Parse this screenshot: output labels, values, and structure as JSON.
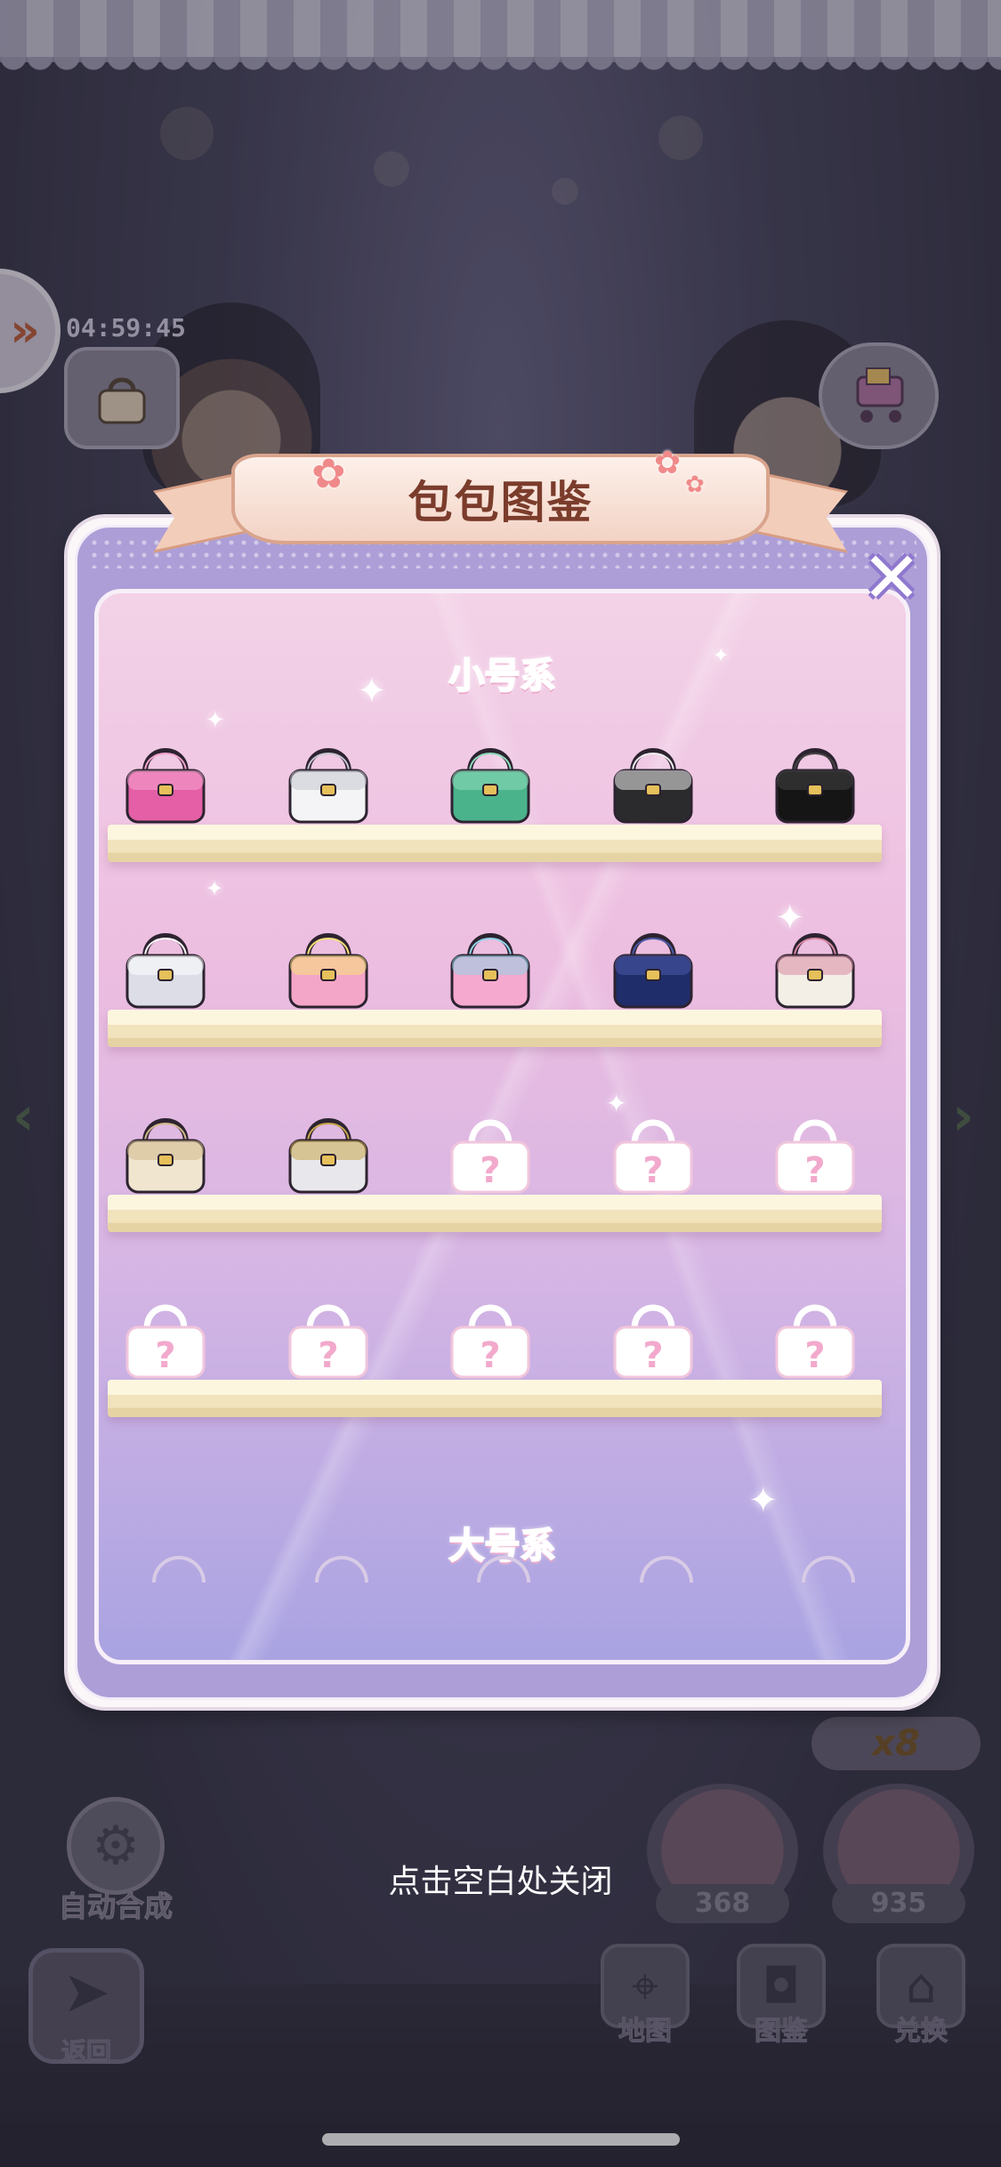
{
  "hud": {
    "timer": "04:59:45",
    "expand_glyph": "»",
    "counter_badge": "x8"
  },
  "icons": {
    "expand": "double-chevron-right-icon",
    "bag_collection": "handbag-icon",
    "shop_cart": "shopping-cart-icon",
    "close": "sparkle-close-icon"
  },
  "modal": {
    "title": "包包图鉴",
    "sections": [
      {
        "name": "小号系"
      },
      {
        "name": "大号系"
      }
    ],
    "small_shelves": [
      [
        {
          "name": "pink-quilted-bag",
          "unlocked": true,
          "body": "#e45fa6",
          "accent": "#f6a6cf"
        },
        {
          "name": "white-flap-bag",
          "unlocked": true,
          "body": "#f4f4f6",
          "accent": "#c7c7d2"
        },
        {
          "name": "green-tote-bag",
          "unlocked": true,
          "body": "#4bb38c",
          "accent": "#8fdcbc"
        },
        {
          "name": "harlequin-bag",
          "unlocked": true,
          "body": "#2b2b2e",
          "accent": "#efefef"
        },
        {
          "name": "black-fur-bag",
          "unlocked": true,
          "body": "#151516",
          "accent": "#444"
        }
      ],
      [
        {
          "name": "silver-pattern-bag",
          "unlocked": true,
          "body": "#dcdde6",
          "accent": "#ffffff"
        },
        {
          "name": "heart-bow-bag",
          "unlocked": true,
          "body": "#f4a6c8",
          "accent": "#f8e07a"
        },
        {
          "name": "pastel-colorblock-bag",
          "unlocked": true,
          "body": "#f5a9cf",
          "accent": "#8fd3e8"
        },
        {
          "name": "navy-bag",
          "unlocked": true,
          "body": "#1f2d6b",
          "accent": "#4a5aa8"
        },
        {
          "name": "floral-clasp-bag",
          "unlocked": true,
          "body": "#f4efe6",
          "accent": "#d98aa3"
        }
      ],
      [
        {
          "name": "cream-quilted-bag",
          "unlocked": true,
          "body": "#f0e5cf",
          "accent": "#d2b98c"
        },
        {
          "name": "chain-quilted-bag",
          "unlocked": true,
          "body": "#e8e8ec",
          "accent": "#c7a54f"
        },
        {
          "name": "locked-bag",
          "unlocked": false
        },
        {
          "name": "locked-bag",
          "unlocked": false
        },
        {
          "name": "locked-bag",
          "unlocked": false
        }
      ],
      [
        {
          "name": "locked-bag",
          "unlocked": false
        },
        {
          "name": "locked-bag",
          "unlocked": false
        },
        {
          "name": "locked-bag",
          "unlocked": false
        },
        {
          "name": "locked-bag",
          "unlocked": false
        },
        {
          "name": "locked-bag",
          "unlocked": false
        }
      ]
    ],
    "locked_mark": "?",
    "close_glyph": "✕"
  },
  "close_hint": "点击空白处关闭",
  "bottom": {
    "auto_merge_label": "自动合成",
    "shop_counts": [
      "368",
      "935"
    ],
    "back_label": "返回",
    "nav": [
      {
        "label": "地图",
        "icon": "map-icon"
      },
      {
        "label": "图鉴",
        "icon": "collection-icon"
      },
      {
        "label": "兑换",
        "icon": "exchange-shop-icon"
      }
    ]
  },
  "colors": {
    "ribbon_text": "#7b3c2c",
    "section_title": "#f8b6d6",
    "locked_bag": "#ffffff"
  }
}
